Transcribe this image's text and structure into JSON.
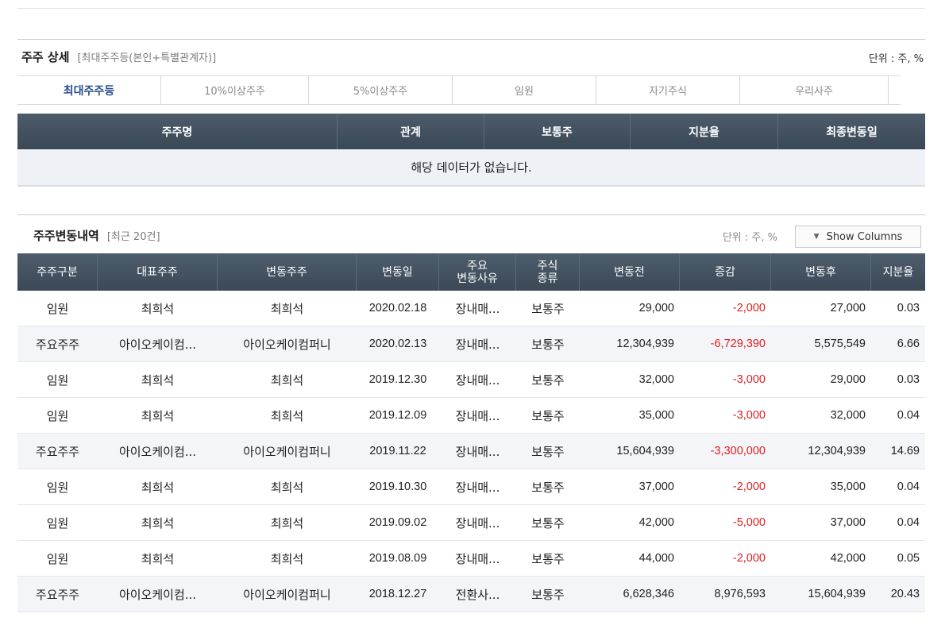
{
  "section1": {
    "title": "주주 상세",
    "subtitle": "[최대주주등(본인+특별관계자)]",
    "unit": "단위 : 주, %",
    "tabs": [
      "최대주주등",
      "10%이상주주",
      "5%이상주주",
      "임원",
      "자기주식",
      "우리사주"
    ],
    "active_tab": "최대주주등",
    "columns": [
      "주주명",
      "관계",
      "보통주",
      "지분율",
      "최종변동일"
    ],
    "no_data": "해당 데이터가 없습니다."
  },
  "section2": {
    "title": "주주변동내역",
    "subtitle": "[최근 20건]",
    "unit": "단위 : 주, %",
    "show_columns_label": "Show Columns",
    "columns": {
      "c0": "주주구분",
      "c1": "대표주주",
      "c2": "변동주주",
      "c3": "변동일",
      "c4a": "주요",
      "c4b": "변동사유",
      "c5a": "주식",
      "c5b": "종류",
      "c6": "변동전",
      "c7": "증감",
      "c8": "변동후",
      "c9": "지분율"
    },
    "rows": [
      {
        "type": "임원",
        "rep": "최희석",
        "holder": "최희석",
        "date": "2020.02.18",
        "reason": "장내매...",
        "kind": "보통주",
        "before": "29,000",
        "change": "-2,000",
        "after": "27,000",
        "ratio": "0.03"
      },
      {
        "type": "주요주주",
        "rep": "아이오케이컴...",
        "holder": "아이오케이컴퍼니",
        "date": "2020.02.13",
        "reason": "장내매...",
        "kind": "보통주",
        "before": "12,304,939",
        "change": "-6,729,390",
        "after": "5,575,549",
        "ratio": "6.66"
      },
      {
        "type": "임원",
        "rep": "최희석",
        "holder": "최희석",
        "date": "2019.12.30",
        "reason": "장내매...",
        "kind": "보통주",
        "before": "32,000",
        "change": "-3,000",
        "after": "29,000",
        "ratio": "0.03"
      },
      {
        "type": "임원",
        "rep": "최희석",
        "holder": "최희석",
        "date": "2019.12.09",
        "reason": "장내매...",
        "kind": "보통주",
        "before": "35,000",
        "change": "-3,000",
        "after": "32,000",
        "ratio": "0.04"
      },
      {
        "type": "주요주주",
        "rep": "아이오케이컴...",
        "holder": "아이오케이컴퍼니",
        "date": "2019.11.22",
        "reason": "장내매...",
        "kind": "보통주",
        "before": "15,604,939",
        "change": "-3,300,000",
        "after": "12,304,939",
        "ratio": "14.69"
      },
      {
        "type": "임원",
        "rep": "최희석",
        "holder": "최희석",
        "date": "2019.10.30",
        "reason": "장내매...",
        "kind": "보통주",
        "before": "37,000",
        "change": "-2,000",
        "after": "35,000",
        "ratio": "0.04"
      },
      {
        "type": "임원",
        "rep": "최희석",
        "holder": "최희석",
        "date": "2019.09.02",
        "reason": "장내매...",
        "kind": "보통주",
        "before": "42,000",
        "change": "-5,000",
        "after": "37,000",
        "ratio": "0.04"
      },
      {
        "type": "임원",
        "rep": "최희석",
        "holder": "최희석",
        "date": "2019.08.09",
        "reason": "장내매...",
        "kind": "보통주",
        "before": "44,000",
        "change": "-2,000",
        "after": "42,000",
        "ratio": "0.05"
      },
      {
        "type": "주요주주",
        "rep": "아이오케이컴...",
        "holder": "아이오케이컴퍼니",
        "date": "2018.12.27",
        "reason": "전환사...",
        "kind": "보통주",
        "before": "6,628,346",
        "change": "8,976,593",
        "after": "15,604,939",
        "ratio": "20.43"
      }
    ]
  },
  "colors": {
    "header_bg": "#3f4d5b",
    "active_tab": "#2a4f8c",
    "negative": "#e02020",
    "alt_row": "#f3f5f9"
  }
}
